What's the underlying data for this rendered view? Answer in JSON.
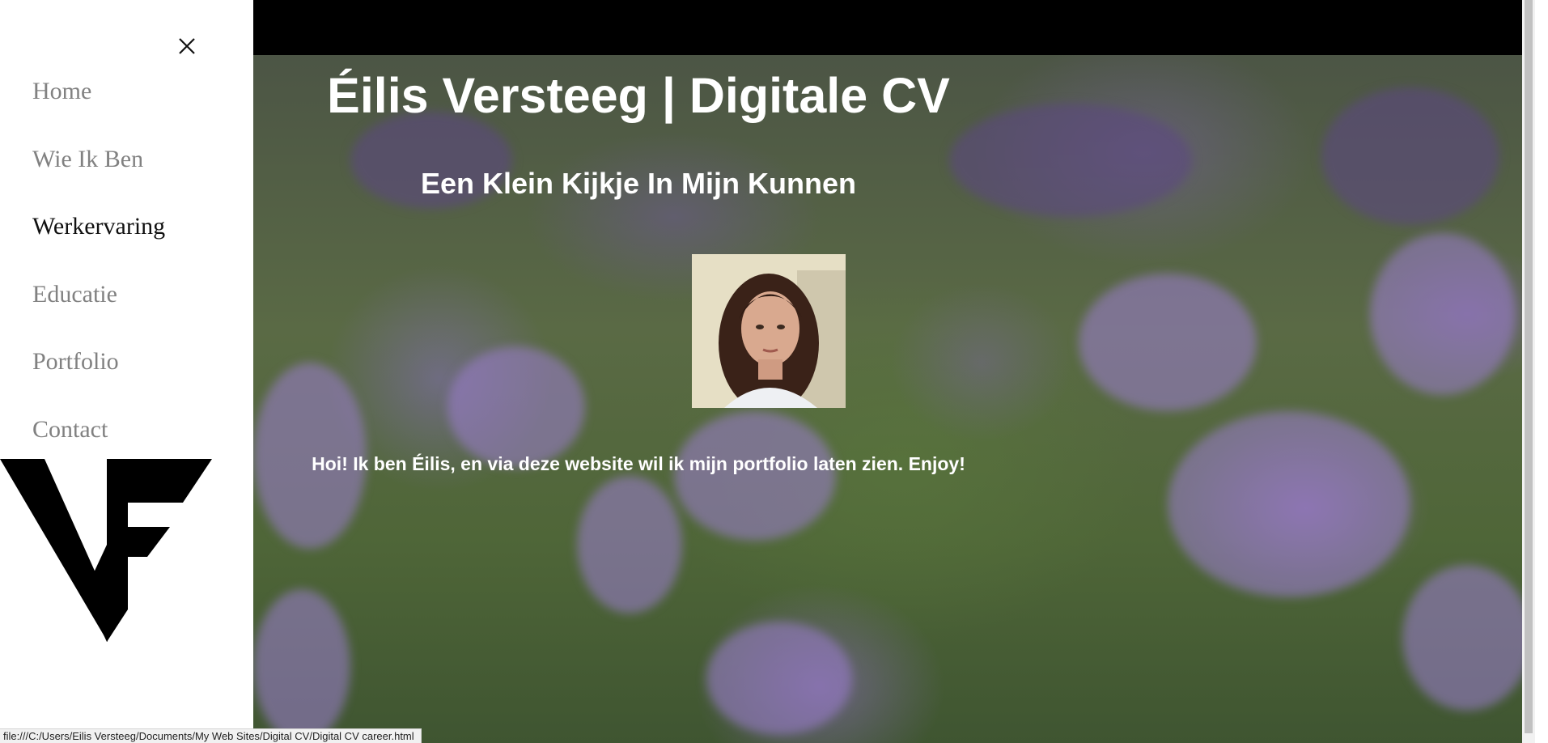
{
  "sidebar": {
    "nav": [
      {
        "label": "Home",
        "active": false
      },
      {
        "label": "Wie Ik Ben",
        "active": false
      },
      {
        "label": "Werkervaring",
        "active": true
      },
      {
        "label": "Educatie",
        "active": false
      },
      {
        "label": "Portfolio",
        "active": false
      },
      {
        "label": "Contact",
        "active": false
      }
    ],
    "close_icon": "close-icon",
    "logo": "VF"
  },
  "hero": {
    "title": "Éilis Versteeg | Digitale CV",
    "subtitle": "Een Klein Kijkje In Mijn Kunnen",
    "intro": "Hoi! Ik ben Éilis, en via deze website wil ik mijn portfolio laten zien. Enjoy!"
  },
  "status_bar": {
    "url": "file:///C:/Users/Eilis Versteeg/Documents/My Web Sites/Digital CV/Digital CV career.html"
  },
  "colors": {
    "nav_inactive": "#818181",
    "nav_active": "#111111",
    "top_bar": "#000000",
    "hero_text": "#ffffff"
  }
}
